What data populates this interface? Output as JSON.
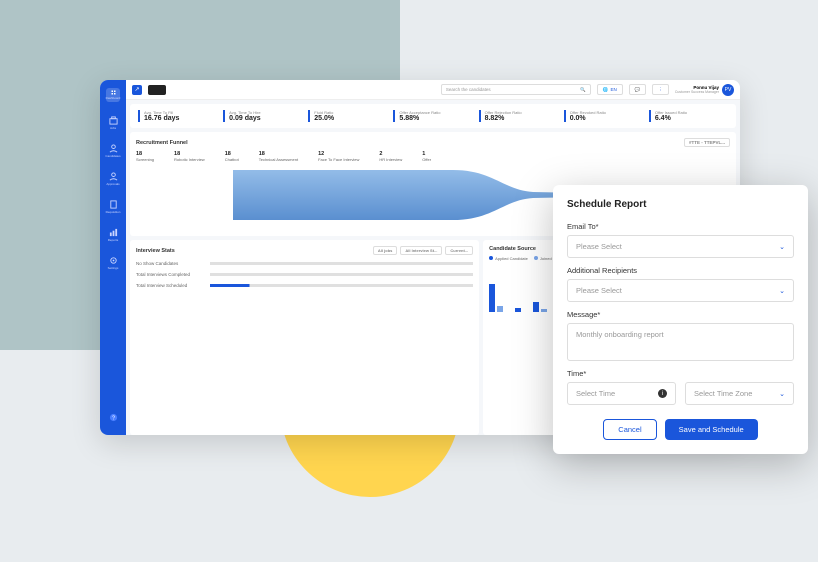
{
  "topbar": {
    "search_placeholder": "Search the candidates",
    "lang": "EN",
    "user_name": "Ponnu Vijay",
    "user_role": "Customer Success Manager",
    "user_initials": "PV"
  },
  "sidebar": {
    "items": [
      {
        "label": "Dashboard"
      },
      {
        "label": "Jobs"
      },
      {
        "label": "Candidates"
      },
      {
        "label": "Approvals"
      },
      {
        "label": "Requisition"
      },
      {
        "label": "Reports"
      },
      {
        "label": "Settings"
      }
    ]
  },
  "kpis": [
    {
      "label": "Avg. Time To Fill",
      "value": "16.76 days"
    },
    {
      "label": "Avg. Time To Hire",
      "value": "0.09 days"
    },
    {
      "label": "Fluid Ratio",
      "value": "25.0%"
    },
    {
      "label": "Offer Acceptance Ratio",
      "value": "5.88%"
    },
    {
      "label": "Offer Rejection Ratio",
      "value": "8.82%"
    },
    {
      "label": "Offer Revoked Ratio",
      "value": "0.0%"
    },
    {
      "label": "Offer Issued Ratio",
      "value": "6.4%"
    }
  ],
  "funnel": {
    "title": "Recruitment Funnel",
    "filter": "#TTE - TTEPVL...",
    "stages": [
      {
        "count": "18",
        "label": "Screening"
      },
      {
        "count": "18",
        "label": "Robotic Interview"
      },
      {
        "count": "18",
        "label": "Chatbot"
      },
      {
        "count": "18",
        "label": "Technical Assessment"
      },
      {
        "count": "12",
        "label": "Face To Face Interview"
      },
      {
        "count": "2",
        "label": "HR Interview"
      },
      {
        "count": "1",
        "label": "Offer"
      }
    ]
  },
  "interview": {
    "title": "Interview Stats",
    "filters": [
      "All jobs",
      "All Interview St...",
      "Current..."
    ],
    "rows": [
      "No Show Candidates",
      "Total Interviews Completed",
      "Total Interview Scheduled"
    ]
  },
  "source": {
    "title": "Candidate Source",
    "legend": [
      "Applied Candidate",
      "Joined Candidate"
    ]
  },
  "modal": {
    "title": "Schedule Report",
    "email_label": "Email To*",
    "email_placeholder": "Please Select",
    "recipients_label": "Additional Recipients",
    "recipients_placeholder": "Please Select",
    "message_label": "Message*",
    "message_placeholder": "Monthly onboarding report",
    "time_label": "Time*",
    "time_placeholder": "Select Time",
    "tz_placeholder": "Select Time Zone",
    "cancel": "Cancel",
    "save": "Save and Schedule"
  },
  "chart_data": {
    "type": "bar",
    "title": "Recruitment Funnel",
    "categories": [
      "Screening",
      "Robotic Interview",
      "Chatbot",
      "Technical Assessment",
      "Face To Face Interview",
      "HR Interview",
      "Offer"
    ],
    "values": [
      18,
      18,
      18,
      18,
      12,
      2,
      1
    ]
  }
}
